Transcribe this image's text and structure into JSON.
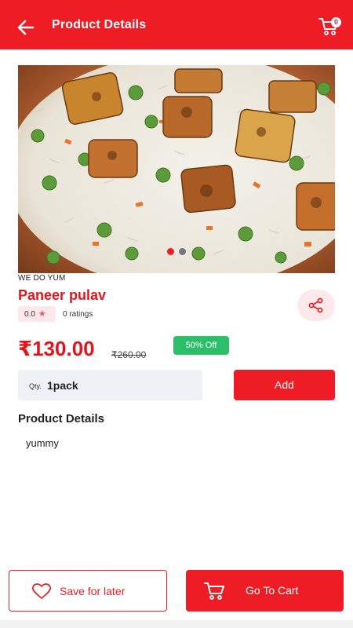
{
  "appbar": {
    "title": "Product Details",
    "back_icon": "arrow-left-icon",
    "cart_icon": "cart-icon",
    "cart_count": "0"
  },
  "product": {
    "brand": "WE DO YUM",
    "name": "Paneer pulav",
    "rating": "0.0",
    "ratings_count": "0 ratings",
    "price": "₹130.00",
    "old_price": "₹260.00",
    "discount": "50% Off",
    "image_slides": 2,
    "active_slide": 1
  },
  "quantity": {
    "label": "Qty.",
    "value": "1pack"
  },
  "actions": {
    "add_label": "Add",
    "save_label": "Save for later",
    "go_to_cart_label": "Go To Cart"
  },
  "details": {
    "heading": "Product Details",
    "description": "yummy"
  },
  "colors": {
    "primary": "#ee1c25",
    "discount": "#2dbe6a",
    "chip_bg": "#fde9e9",
    "qty_bg": "#eef2f7"
  }
}
